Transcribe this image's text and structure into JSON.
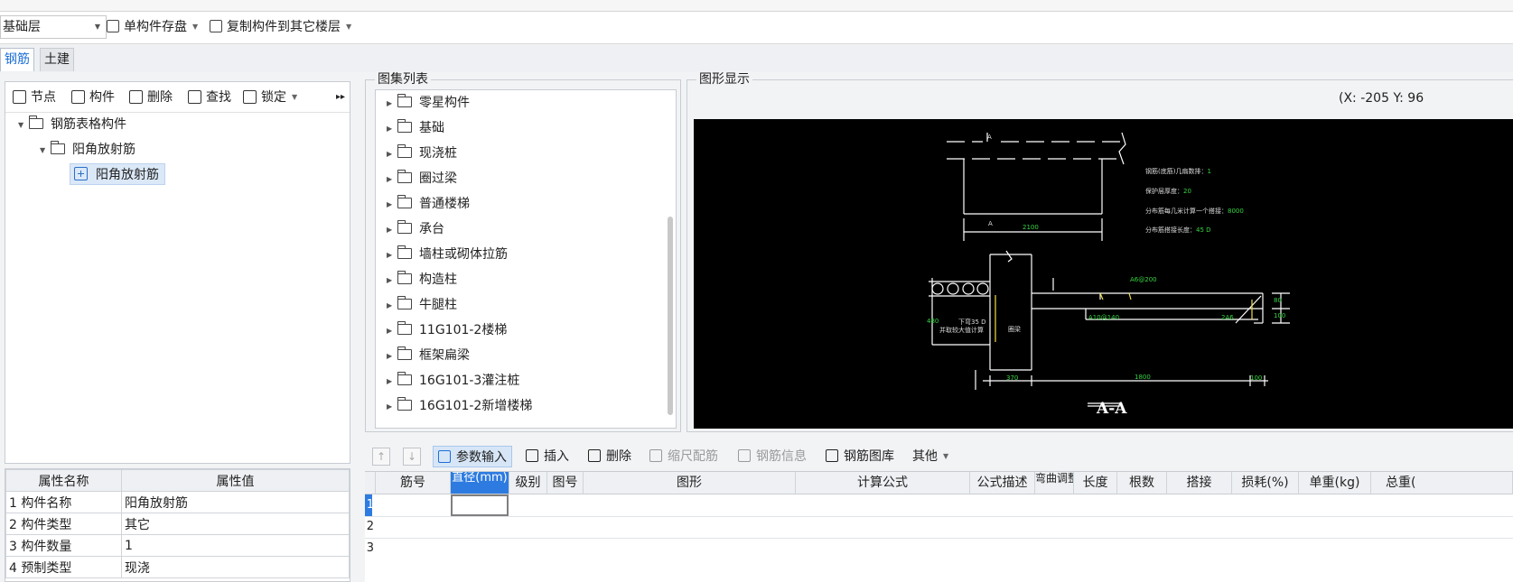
{
  "toolbar": {
    "floor_value": "基础层",
    "save_label": "单构件存盘",
    "copy_label": "复制构件到其它楼层"
  },
  "tabs": [
    {
      "label": "钢筋",
      "active": true
    },
    {
      "label": "土建",
      "active": false
    }
  ],
  "left_toolbar": {
    "node_label": "节点",
    "component_label": "构件",
    "delete_label": "删除",
    "find_label": "查找",
    "lock_label": "锁定",
    "more_label": "▸▸"
  },
  "tree": [
    {
      "label": "钢筋表格构件",
      "level": 0
    },
    {
      "label": "阳角放射筋",
      "level": 1
    },
    {
      "label": "阳角放射筋",
      "level": 2,
      "selected": true
    }
  ],
  "properties": {
    "header_name": "属性名称",
    "header_value": "属性值",
    "rows": [
      {
        "no": "1",
        "name": "构件名称",
        "value": "阳角放射筋"
      },
      {
        "no": "2",
        "name": "构件类型",
        "value": "其它"
      },
      {
        "no": "3",
        "name": "构件数量",
        "value": "1"
      },
      {
        "no": "4",
        "name": "预制类型",
        "value": "现浇"
      }
    ]
  },
  "atlas": {
    "title": "图集列表",
    "items": [
      "零星构件",
      "基础",
      "现浇桩",
      "圈过梁",
      "普通楼梯",
      "承台",
      "墙柱或砌体拉筋",
      "构造柱",
      "牛腿柱",
      "11G101-2楼梯",
      "框架扁梁",
      "16G101-3灌注桩",
      "16G101-2新增楼梯"
    ]
  },
  "graphic": {
    "title": "图形显示",
    "coord": "(X: -205 Y: 96",
    "notes": {
      "line1_label": "钢筋(底筋)几扇数排：",
      "line1_value": "1",
      "line2_label": "保护层厚度：",
      "line2_value": "20",
      "line3_label": "分布筋每几米计算一个搭接：",
      "line3_value": "8000",
      "line4_label": "分布筋搭接长度：",
      "line4_value": "45 D"
    },
    "dims": {
      "d2100": "2100",
      "d370": "370",
      "d1800": "1800",
      "d100": "100",
      "a6": "A6@200",
      "a10": "A10@140",
      "n2a6": "2A6",
      "note_down": "下弯35 D",
      "note_take": "并取较大值计算",
      "ring_beam": "圈梁",
      "section": "A-A",
      "d480": "480",
      "d100b": "100",
      "d80": "80",
      "dA": "A"
    },
    "colors": {
      "canvas_bg": "#000000",
      "line": "#ffffff",
      "dim_text": "#35d640",
      "accent": "#f0e040"
    }
  },
  "bottom_toolbar": {
    "param_input": "参数输入",
    "insert": "插入",
    "delete": "删除",
    "scale": "缩尺配筋",
    "rebar_info": "钢筋信息",
    "rebar_lib": "钢筋图库",
    "other": "其他"
  },
  "grid": {
    "headers": [
      "筋号",
      "直径(mm)",
      "级别",
      "图号",
      "图形",
      "计算公式",
      "公式描述",
      "弯曲调整",
      "长度",
      "根数",
      "搭接",
      "损耗(%)",
      "单重(kg)",
      "总重("
    ],
    "row_numbers": [
      "1",
      "2",
      "3"
    ]
  }
}
